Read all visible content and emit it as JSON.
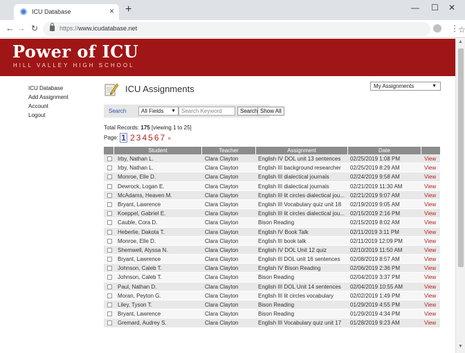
{
  "browser": {
    "tab_title": "ICU Database",
    "url": "https://www.icudatabase.net",
    "url_scheme_prefix": "https://",
    "url_host": "www.icudatabase.net"
  },
  "header": {
    "title": "Power of ICU",
    "subtitle": "HILL VALLEY HIGH SCHOOL",
    "brand_color": "#a01515"
  },
  "sidebar": {
    "items": [
      {
        "label": "ICU Database"
      },
      {
        "label": "Add Assignment"
      },
      {
        "label": "Account"
      },
      {
        "label": "Logout"
      }
    ]
  },
  "main": {
    "title": "ICU Assignments",
    "view_select": "My Assignments",
    "search": {
      "label": "Search",
      "field_select": "All Fields",
      "keyword_placeholder": "Search Keyword",
      "search_button": "Search",
      "show_all_button": "Show All"
    },
    "records": {
      "prefix": "Total Records:",
      "total": "175",
      "range": "[viewing 1 to 25]"
    },
    "pager": {
      "label": "Page:",
      "current": "1",
      "pages": [
        "2",
        "3",
        "4",
        "5",
        "6",
        "7"
      ],
      "next": "»"
    },
    "table": {
      "columns": [
        "Student",
        "Teacher",
        "Assignment",
        "Date"
      ],
      "view_label": "View",
      "rows": [
        {
          "student": "Irby, Nathan L.",
          "teacher": "Clara Clayton",
          "assignment": "English IV DOL unit 13 sentences",
          "date": "02/25/2019 1:08 PM"
        },
        {
          "student": "Irby, Nathan L.",
          "teacher": "Clara Clayton",
          "assignment": "English III background researcher",
          "date": "02/25/2019 8:29 AM"
        },
        {
          "student": "Monroe, Elle D.",
          "teacher": "Clara Clayton",
          "assignment": "English III dialectical journals",
          "date": "02/24/2019 9:58 AM"
        },
        {
          "student": "Dewrock, Logan E.",
          "teacher": "Clara Clayton",
          "assignment": "English III dialectical journals",
          "date": "02/21/2019 11:30 AM"
        },
        {
          "student": "McAdams, Heaven M.",
          "teacher": "Clara Clayton",
          "assignment": "English III lit circles dialectical jou...",
          "date": "02/21/2019 9:07 AM"
        },
        {
          "student": "Bryant, Lawrence",
          "teacher": "Clara Clayton",
          "assignment": "English III Vocabulary quiz unit 18",
          "date": "02/19/2019 9:05 AM"
        },
        {
          "student": "Koeppel, Gabriel E.",
          "teacher": "Clara Clayton",
          "assignment": "English III lit circles dialectical jou...",
          "date": "02/15/2019 2:16 PM"
        },
        {
          "student": "Cauble, Cora D.",
          "teacher": "Clara Clayton",
          "assignment": "Bison Reading",
          "date": "02/15/2019 8:02 AM"
        },
        {
          "student": "Heberlie, Dakota T.",
          "teacher": "Clara Clayton",
          "assignment": "English IV Book Talk",
          "date": "02/11/2019 3:11 PM"
        },
        {
          "student": "Monroe, Elle D.",
          "teacher": "Clara Clayton",
          "assignment": "English III book talk",
          "date": "02/11/2019 12:09 PM"
        },
        {
          "student": "Shemwell, Alyssa N.",
          "teacher": "Clara Clayton",
          "assignment": "English IV DOL Unit 12 quiz",
          "date": "02/10/2019 11:50 AM"
        },
        {
          "student": "Bryant, Lawrence",
          "teacher": "Clara Clayton",
          "assignment": "English III DOL unit 16 sentences",
          "date": "02/08/2019 8:57 AM"
        },
        {
          "student": "Johnson, Caleb T.",
          "teacher": "Clara Clayton",
          "assignment": "English IV Bison Reading",
          "date": "02/06/2019 2:36 PM"
        },
        {
          "student": "Johnson, Caleb T.",
          "teacher": "Clara Clayton",
          "assignment": "Bison Reading",
          "date": "02/04/2019 3:37 PM"
        },
        {
          "student": "Paul, Nathan D.",
          "teacher": "Clara Clayton",
          "assignment": "English III DOL Unit 14 sentences",
          "date": "02/04/2019 10:55 AM"
        },
        {
          "student": "Moran, Peyton G.",
          "teacher": "Clara Clayton",
          "assignment": "English III lit circles vocabulary",
          "date": "02/02/2019 1:49 PM"
        },
        {
          "student": "Liley, Tyson T.",
          "teacher": "Clara Clayton",
          "assignment": "Bison Reading",
          "date": "01/29/2019 4:55 PM"
        },
        {
          "student": "Bryant, Lawrence",
          "teacher": "Clara Clayton",
          "assignment": "Bison Reading",
          "date": "01/29/2019 4:34 PM"
        },
        {
          "student": "Gremard, Audrey S.",
          "teacher": "Clara Clayton",
          "assignment": "English III Vocabulary quiz unit 17",
          "date": "01/28/2019 9:23 AM"
        }
      ]
    }
  }
}
